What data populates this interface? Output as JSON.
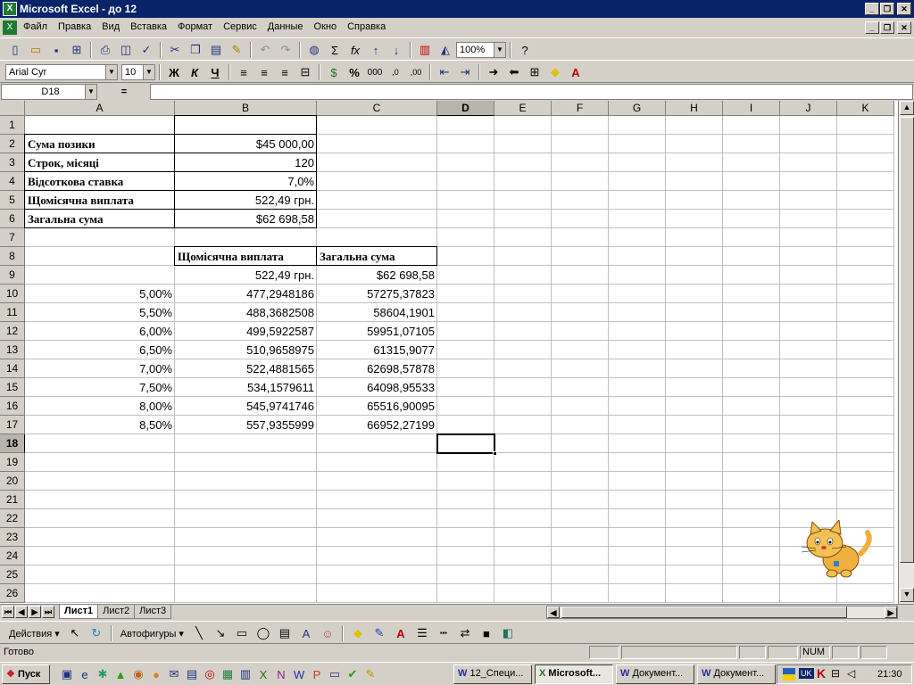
{
  "window": {
    "title": "Microsoft Excel - до 12"
  },
  "menu": [
    "Файл",
    "Правка",
    "Вид",
    "Вставка",
    "Формат",
    "Сервис",
    "Данные",
    "Окно",
    "Справка"
  ],
  "toolbar": {
    "zoom": "100%"
  },
  "format_toolbar": {
    "font": "Arial Cyr",
    "size": "10"
  },
  "formula": {
    "name_box": "D18",
    "equals": "="
  },
  "columns": [
    {
      "label": "A",
      "w": 168
    },
    {
      "label": "B",
      "w": 159
    },
    {
      "label": "C",
      "w": 135
    },
    {
      "label": "D",
      "w": 64
    },
    {
      "label": "E",
      "w": 64
    },
    {
      "label": "F",
      "w": 64
    },
    {
      "label": "G",
      "w": 64
    },
    {
      "label": "H",
      "w": 64
    },
    {
      "label": "I",
      "w": 64
    },
    {
      "label": "J",
      "w": 64
    },
    {
      "label": "K",
      "w": 64
    }
  ],
  "rows": [
    {
      "n": "1",
      "cells": []
    },
    {
      "n": "2",
      "cells": [
        {
          "c": 0,
          "v": "Сума позики",
          "b": true
        },
        {
          "c": 1,
          "v": "$45 000,00",
          "r": true
        }
      ]
    },
    {
      "n": "3",
      "cells": [
        {
          "c": 0,
          "v": "Строк, місяці",
          "b": true
        },
        {
          "c": 1,
          "v": "120",
          "r": true
        }
      ]
    },
    {
      "n": "4",
      "cells": [
        {
          "c": 0,
          "v": "Відсоткова ставка",
          "b": true
        },
        {
          "c": 1,
          "v": "7,0%",
          "r": true
        }
      ]
    },
    {
      "n": "5",
      "cells": [
        {
          "c": 0,
          "v": "Щомісячна виплата",
          "b": true
        },
        {
          "c": 1,
          "v": "522,49 грн.",
          "r": true
        }
      ]
    },
    {
      "n": "6",
      "cells": [
        {
          "c": 0,
          "v": "Загальна сума",
          "b": true
        },
        {
          "c": 1,
          "v": "$62 698,58",
          "r": true
        }
      ]
    },
    {
      "n": "7",
      "cells": []
    },
    {
      "n": "8",
      "cells": [
        {
          "c": 1,
          "v": "Щомісячна виплата",
          "b": true
        },
        {
          "c": 2,
          "v": "Загальна сума",
          "b": true
        }
      ]
    },
    {
      "n": "9",
      "cells": [
        {
          "c": 1,
          "v": "522,49 грн.",
          "r": true
        },
        {
          "c": 2,
          "v": "$62 698,58",
          "r": true
        }
      ]
    },
    {
      "n": "10",
      "cells": [
        {
          "c": 0,
          "v": "5,00%",
          "r": true
        },
        {
          "c": 1,
          "v": "477,2948186",
          "r": true
        },
        {
          "c": 2,
          "v": "57275,37823",
          "r": true
        }
      ]
    },
    {
      "n": "11",
      "cells": [
        {
          "c": 0,
          "v": "5,50%",
          "r": true
        },
        {
          "c": 1,
          "v": "488,3682508",
          "r": true
        },
        {
          "c": 2,
          "v": "58604,1901",
          "r": true
        }
      ]
    },
    {
      "n": "12",
      "cells": [
        {
          "c": 0,
          "v": "6,00%",
          "r": true
        },
        {
          "c": 1,
          "v": "499,5922587",
          "r": true
        },
        {
          "c": 2,
          "v": "59951,07105",
          "r": true
        }
      ]
    },
    {
      "n": "13",
      "cells": [
        {
          "c": 0,
          "v": "6,50%",
          "r": true
        },
        {
          "c": 1,
          "v": "510,9658975",
          "r": true
        },
        {
          "c": 2,
          "v": "61315,9077",
          "r": true
        }
      ]
    },
    {
      "n": "14",
      "cells": [
        {
          "c": 0,
          "v": "7,00%",
          "r": true
        },
        {
          "c": 1,
          "v": "522,4881565",
          "r": true
        },
        {
          "c": 2,
          "v": "62698,57878",
          "r": true
        }
      ]
    },
    {
      "n": "15",
      "cells": [
        {
          "c": 0,
          "v": "7,50%",
          "r": true
        },
        {
          "c": 1,
          "v": "534,1579611",
          "r": true
        },
        {
          "c": 2,
          "v": "64098,95533",
          "r": true
        }
      ]
    },
    {
      "n": "16",
      "cells": [
        {
          "c": 0,
          "v": "8,00%",
          "r": true
        },
        {
          "c": 1,
          "v": "545,9741746",
          "r": true
        },
        {
          "c": 2,
          "v": "65516,90095",
          "r": true
        }
      ]
    },
    {
      "n": "17",
      "cells": [
        {
          "c": 0,
          "v": "8,50%",
          "r": true
        },
        {
          "c": 1,
          "v": "557,9355999",
          "r": true
        },
        {
          "c": 2,
          "v": "66952,27199",
          "r": true
        }
      ]
    },
    {
      "n": "18",
      "cells": []
    },
    {
      "n": "19",
      "cells": []
    },
    {
      "n": "20",
      "cells": []
    },
    {
      "n": "21",
      "cells": []
    },
    {
      "n": "22",
      "cells": []
    },
    {
      "n": "23",
      "cells": []
    },
    {
      "n": "24",
      "cells": []
    },
    {
      "n": "25",
      "cells": []
    },
    {
      "n": "26",
      "cells": []
    }
  ],
  "selected": {
    "row": "18",
    "col": "D"
  },
  "sheets": [
    "Лист1",
    "Лист2",
    "Лист3"
  ],
  "draw_toolbar": {
    "actions": "Действия",
    "autoshapes": "Автофигуры"
  },
  "status": {
    "text": "Готово",
    "num": "NUM"
  },
  "taskbar": {
    "start": "Пуск",
    "tasks": [
      {
        "label": "12_Специ...",
        "active": false
      },
      {
        "label": "Microsoft...",
        "active": true
      },
      {
        "label": "Документ...",
        "active": false
      },
      {
        "label": "Документ...",
        "active": false
      }
    ],
    "lang": "UK",
    "clock": "21:30"
  }
}
